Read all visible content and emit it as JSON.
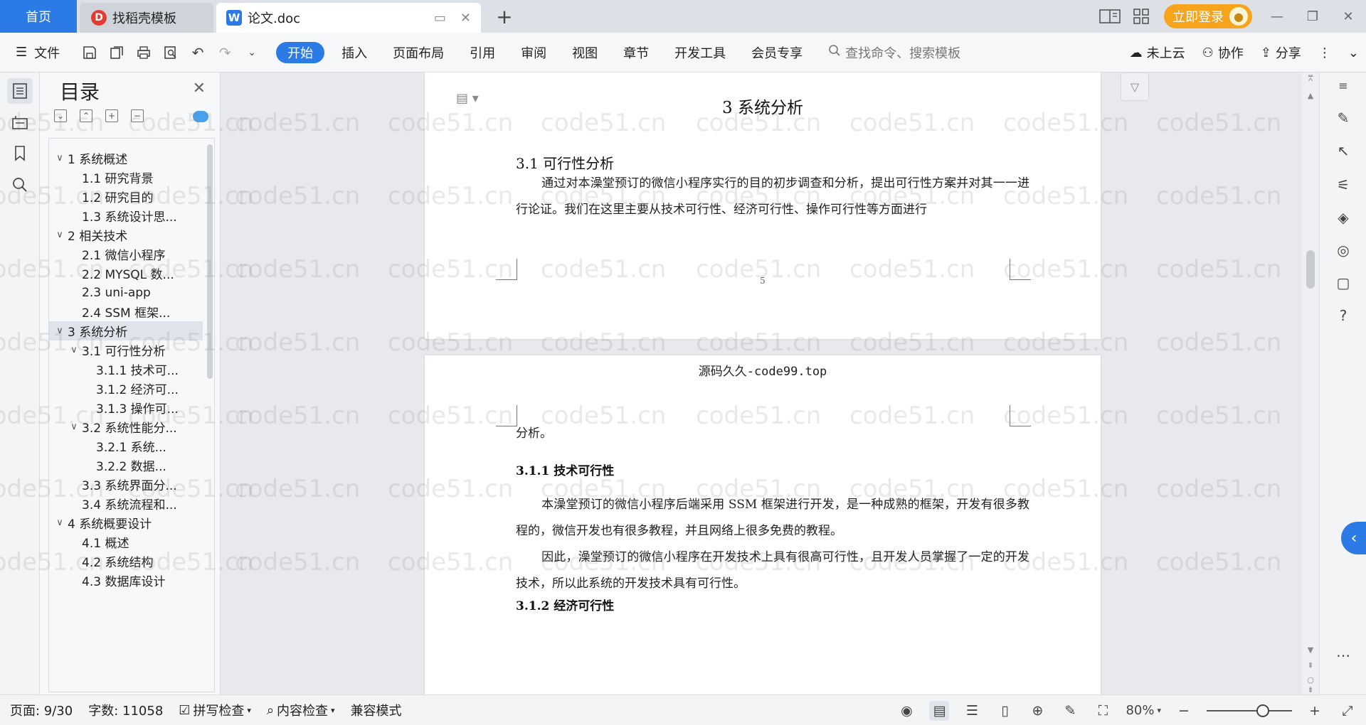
{
  "titlebar": {
    "home_tab": "首页",
    "template_tab": "找稻壳模板",
    "template_logo": "D",
    "doc_tab": "论文.doc",
    "doc_logo": "W",
    "login_label": "立即登录"
  },
  "ribbon": {
    "file_label": "文件",
    "tabs": [
      "开始",
      "插入",
      "页面布局",
      "引用",
      "审阅",
      "视图",
      "章节",
      "开发工具",
      "会员专享"
    ],
    "active_tab": "开始",
    "search_placeholder": "查找命令、搜索模板",
    "cloud_label": "未上云",
    "collab_label": "协作",
    "share_label": "分享"
  },
  "toc": {
    "title": "目录",
    "items": [
      {
        "label": "1 系统概述",
        "level": 1,
        "expanded": true
      },
      {
        "label": "1.1  研究背景",
        "level": 2
      },
      {
        "label": "1.2 研究目的",
        "level": 2
      },
      {
        "label": "1.3 系统设计思...",
        "level": 2
      },
      {
        "label": "2 相关技术",
        "level": 1,
        "expanded": true
      },
      {
        "label": "2.1 微信小程序",
        "level": 2
      },
      {
        "label": "2.2 MYSQL 数...",
        "level": 2
      },
      {
        "label": "2.3 uni-app",
        "level": 2
      },
      {
        "label": "2.4 SSM 框架...",
        "level": 2
      },
      {
        "label": "3 系统分析",
        "level": 1,
        "expanded": true,
        "selected": true
      },
      {
        "label": "3.1 可行性分析",
        "level": 2,
        "expanded": true
      },
      {
        "label": "3.1.1 技术可...",
        "level": 3
      },
      {
        "label": "3.1.2 经济可...",
        "level": 3
      },
      {
        "label": "3.1.3 操作可...",
        "level": 3
      },
      {
        "label": "3.2 系统性能分...",
        "level": 2,
        "expanded": true
      },
      {
        "label": "3.2.1  系统...",
        "level": 3
      },
      {
        "label": "3.2.2  数据...",
        "level": 3
      },
      {
        "label": "3.3 系统界面分...",
        "level": 2
      },
      {
        "label": "3.4 系统流程和...",
        "level": 2
      },
      {
        "label": "4 系统概要设计",
        "level": 1,
        "expanded": true
      },
      {
        "label": "4.1 概述",
        "level": 2
      },
      {
        "label": "4.2 系统结构",
        "level": 2
      },
      {
        "label": "4.3 数据库设计",
        "level": 2
      }
    ]
  },
  "document": {
    "page1": {
      "chapter_title": "3 系统分析",
      "section_title": "3.1 可行性分析",
      "para1": "通过对本澡堂预订的微信小程序实行的目的初步调查和分析，提出可行性方案并对其一一进行论证。我们在这里主要从技术可行性、经济可行性、操作可行性等方面进行",
      "page_number": "5"
    },
    "page2": {
      "header": "源码久久-code99.top",
      "para_cont": "分析。",
      "sub1_title": "3.1.1 技术可行性",
      "sub1_para1": "本澡堂预订的微信小程序后端采用 SSM 框架进行开发，是一种成熟的框架，开发有很多教程的，微信开发也有很多教程，并且网络上很多免费的教程。",
      "sub1_para2": "因此，澡堂预订的微信小程序在开发技术上具有很高可行性，且开发人员掌握了一定的开发技术，所以此系统的开发技术具有可行性。",
      "sub2_title": "3.1.2 经济可行性"
    }
  },
  "watermark_text": "code51.cn",
  "statusbar": {
    "page_info": "页面: 9/30",
    "word_count": "字数: 11058",
    "spell_check": "拼写检查",
    "content_check": "内容检查",
    "compat_mode": "兼容模式",
    "zoom": "80%",
    "zoom_level_percent": 80
  }
}
